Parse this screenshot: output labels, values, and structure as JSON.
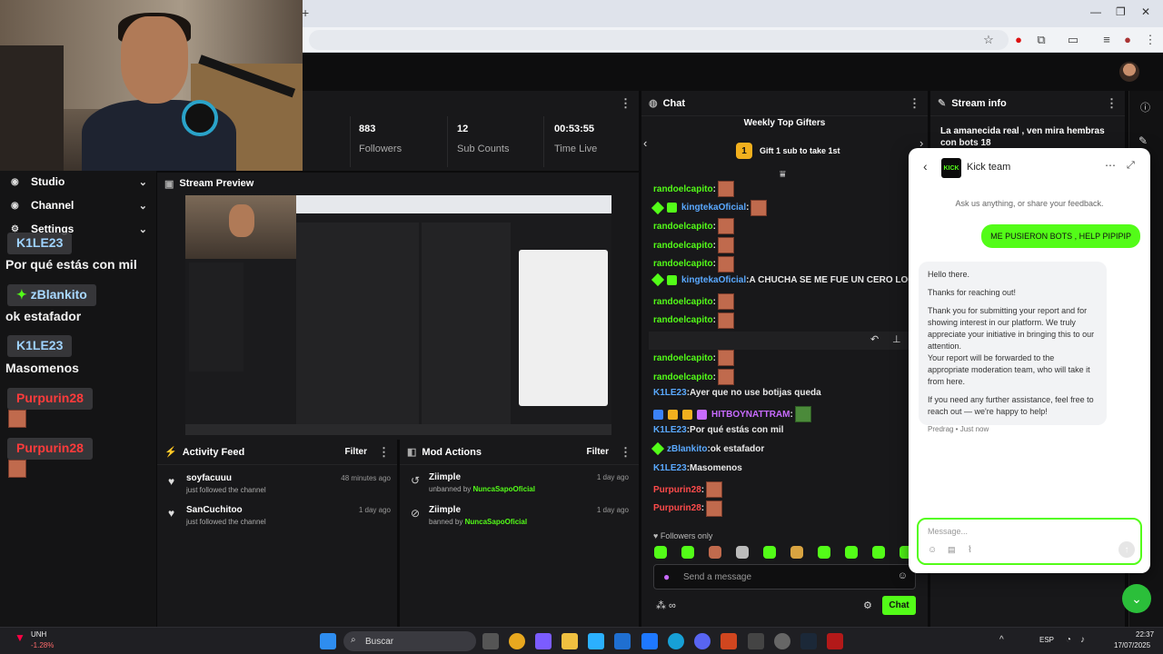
{
  "browser": {
    "new_tab": "+",
    "minimize": "—",
    "restore": "❐",
    "close": "✕"
  },
  "stats": [
    {
      "value": "883",
      "label": "Followers"
    },
    {
      "value": "12",
      "label": "Sub Counts"
    },
    {
      "value": "00:53:55",
      "label": "Time Live"
    }
  ],
  "left_menu": [
    {
      "label": "Studio",
      "icon": "studio-icon"
    },
    {
      "label": "Channel",
      "icon": "channel-icon"
    },
    {
      "label": "Settings",
      "icon": "settings-icon"
    }
  ],
  "overlay_chat": [
    {
      "user": "K1LE23",
      "message": "Por qué estás con mil",
      "color": "#9fd3ff",
      "badge": ""
    },
    {
      "user": "zBlankito",
      "message": "ok estafador",
      "color": "#a8d8ff",
      "badge": "✦"
    },
    {
      "user": "K1LE23",
      "message": "Masomenos",
      "color": "#9fd3ff",
      "badge": ""
    },
    {
      "user": "Purpurin28",
      "message": "",
      "color": "#ff3b3b",
      "badge": ""
    },
    {
      "user": "Purpurin28",
      "message": "",
      "color": "#ff3b3b",
      "badge": ""
    }
  ],
  "stream_preview": {
    "title": "Stream Preview"
  },
  "activity_feed": {
    "title": "Activity Feed",
    "filter": "Filter",
    "items": [
      {
        "user": "soyfacuuu",
        "action": "just followed the channel",
        "time": "48 minutes ago"
      },
      {
        "user": "SanCuchitoo",
        "action": "just followed the channel",
        "time": "1 day ago"
      }
    ]
  },
  "mod_actions": {
    "title": "Mod Actions",
    "filter": "Filter",
    "items": [
      {
        "user": "Ziimple",
        "action": "unbanned by",
        "target": "NuncaSapoOficial",
        "time": "1 day ago"
      },
      {
        "user": "Ziimple",
        "action": "banned by",
        "target": "NuncaSapoOficial",
        "time": "1 day ago"
      }
    ]
  },
  "chat": {
    "title": "Chat",
    "gifters_title": "Weekly Top Gifters",
    "gifters_cta": "Gift 1 sub to take 1st",
    "gifters_rank": "1",
    "messages": [
      {
        "user": "randoelcapito",
        "text": "",
        "color": "green",
        "emote": true,
        "badges": ""
      },
      {
        "user": "kingtekaOficial",
        "text": "",
        "color": "blue",
        "emote": true,
        "badges": "gs"
      },
      {
        "user": "randoelcapito",
        "text": "",
        "color": "green",
        "emote": true,
        "badges": ""
      },
      {
        "user": "randoelcapito",
        "text": "",
        "color": "green",
        "emote": true,
        "badges": ""
      },
      {
        "user": "randoelcapito",
        "text": "",
        "color": "green",
        "emote": true,
        "badges": ""
      },
      {
        "user": "kingtekaOficial",
        "text": "A CHUCHA SE ME FUE UN CERO LOCO",
        "color": "blue",
        "emote": false,
        "badges": "gs"
      },
      {
        "user": "randoelcapito",
        "text": "",
        "color": "green",
        "emote": true,
        "badges": ""
      },
      {
        "user": "randoelcapito",
        "text": "",
        "color": "green",
        "emote": true,
        "badges": ""
      },
      {
        "user": "randoelcapito",
        "text": "",
        "color": "green",
        "emote": true,
        "badges": ""
      },
      {
        "user": "randoelcapito",
        "text": "",
        "color": "green",
        "emote": true,
        "badges": ""
      },
      {
        "user": "randoelcapito",
        "text": "",
        "color": "green",
        "emote": true,
        "badges": ""
      },
      {
        "user": "K1LE23",
        "text": "Ayer que no use botijas queda",
        "color": "blue",
        "emote": false,
        "badges": ""
      },
      {
        "user": "HITBOYNATTRAM",
        "text": "",
        "color": "purple",
        "emote": true,
        "badges": "multi"
      },
      {
        "user": "K1LE23",
        "text": "Por qué estás con mil",
        "color": "blue",
        "emote": false,
        "badges": ""
      },
      {
        "user": "zBlankito",
        "text": "ok estafador",
        "color": "blue",
        "emote": false,
        "badges": "g"
      },
      {
        "user": "K1LE23",
        "text": "Masomenos",
        "color": "blue",
        "emote": false,
        "badges": ""
      },
      {
        "user": "Purpurin28",
        "text": "",
        "color": "red",
        "emote": true,
        "badges": ""
      },
      {
        "user": "Purpurin28",
        "text": "",
        "color": "red",
        "emote": true,
        "badges": ""
      }
    ],
    "followers_only": "Followers only",
    "input_placeholder": "Send a message",
    "send_label": "Chat"
  },
  "stream_info": {
    "title": "Stream info",
    "stream_title": "La amanecida real , ven mira hembras con bots 18"
  },
  "support_widget": {
    "team_name": "Kick team",
    "logo_text": "KICK",
    "intro": "Ask us anything, or share your feedback.",
    "user_message": "ME PUSIERON BOTS , HELP PIPIPIP",
    "bot_paragraphs": [
      "Hello there.",
      "Thanks for reaching out!",
      "Thank you for submitting your report and for showing interest in our platform. We truly appreciate your initiative in bringing this to our attention.\nYour report will be forwarded to the appropriate moderation team, who will take it from here.",
      "If you need any further assistance, feel free to reach out — we're happy to help!"
    ],
    "meta": "Predrag • Just now",
    "input_placeholder": "Message..."
  },
  "taskbar": {
    "ticker": "UNH",
    "ticker_change": "-1.28%",
    "search_placeholder": "Buscar",
    "language": "ESP",
    "time": "22:37",
    "date": "17/07/2025"
  }
}
